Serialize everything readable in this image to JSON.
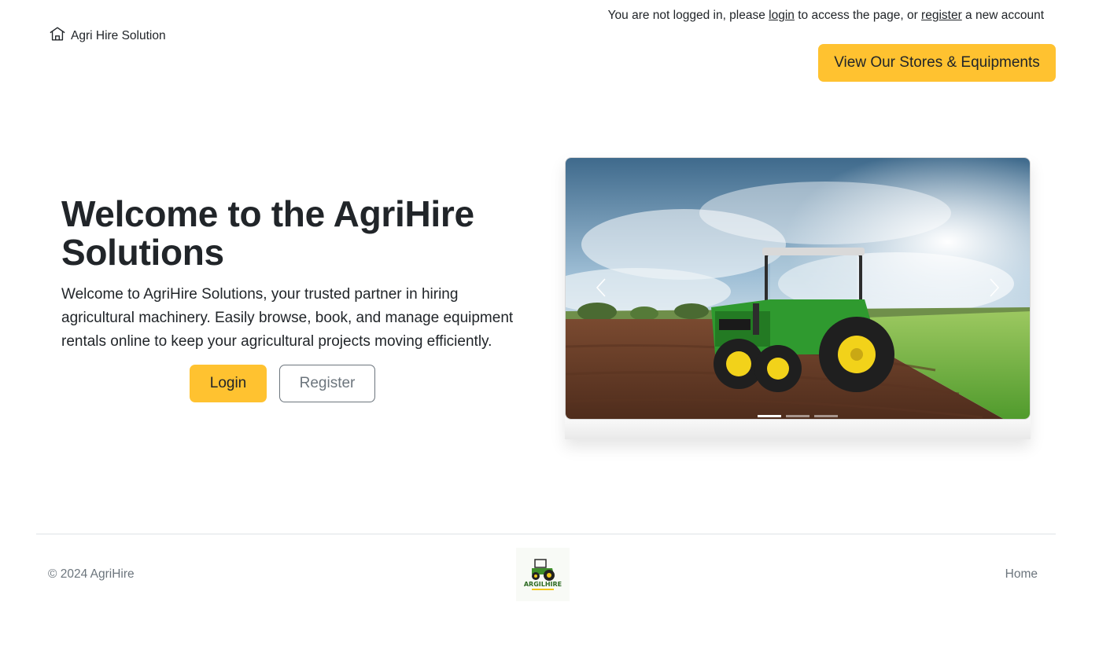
{
  "header": {
    "notice_prefix": "You are not logged in, please ",
    "notice_login": "login",
    "notice_middle": " to access the page, or ",
    "notice_register": "register",
    "notice_suffix": " a new account",
    "brand": "Agri Hire Solution",
    "brand_icon": "home-icon",
    "stores_button": "View Our Stores & Equipments"
  },
  "hero": {
    "title": "Welcome to the AgriHire Solutions",
    "description": "Welcome to AgriHire Solutions, your trusted partner in hiring agricultural machinery. Easily browse, book, and manage equipment rentals online to keep your agricultural projects moving efficiently.",
    "login_button": "Login",
    "register_button": "Register"
  },
  "carousel": {
    "slides": 3,
    "active_slide": 1,
    "prev_icon": "chevron-left-icon",
    "next_icon": "chevron-right-icon"
  },
  "footer": {
    "copyright": "© 2024 AgriHire",
    "logo_text": "ARGILHIRE",
    "home_link": "Home"
  },
  "colors": {
    "accent": "#ffc230",
    "text": "#212529",
    "muted": "#6c757d"
  }
}
